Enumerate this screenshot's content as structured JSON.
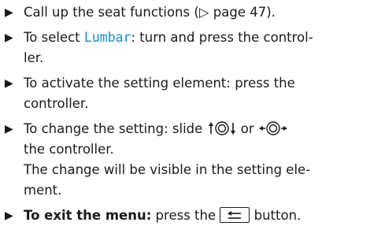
{
  "steps": [
    {
      "pre": "Call up the seat functions (",
      "ref_marker": "▷",
      "ref_text": "page 47",
      "post": ")."
    },
    {
      "pre": "To select ",
      "highlight": "Lumbar",
      "line1_post": ": turn and press the control-",
      "line2": "ler."
    },
    {
      "line1": "To activate the setting element: press the",
      "line2": "controller."
    },
    {
      "pre": "To change the setting: slide ",
      "mid": " or ",
      "line1_post": "",
      "line2": "the controller.",
      "line3": "The change will be visible in the setting ele-",
      "line4": "ment."
    },
    {
      "bold": "To exit the menu:",
      "pre": " press the ",
      "post": " button."
    }
  ],
  "icons": {
    "bullet": "triangle-right",
    "slide_vertical": "controller-slide-up-down",
    "slide_horizontal": "controller-slide-left-right",
    "back_button": "back-button"
  },
  "colors": {
    "highlight": "#1a8ad1",
    "text": "#1a1a1a"
  }
}
